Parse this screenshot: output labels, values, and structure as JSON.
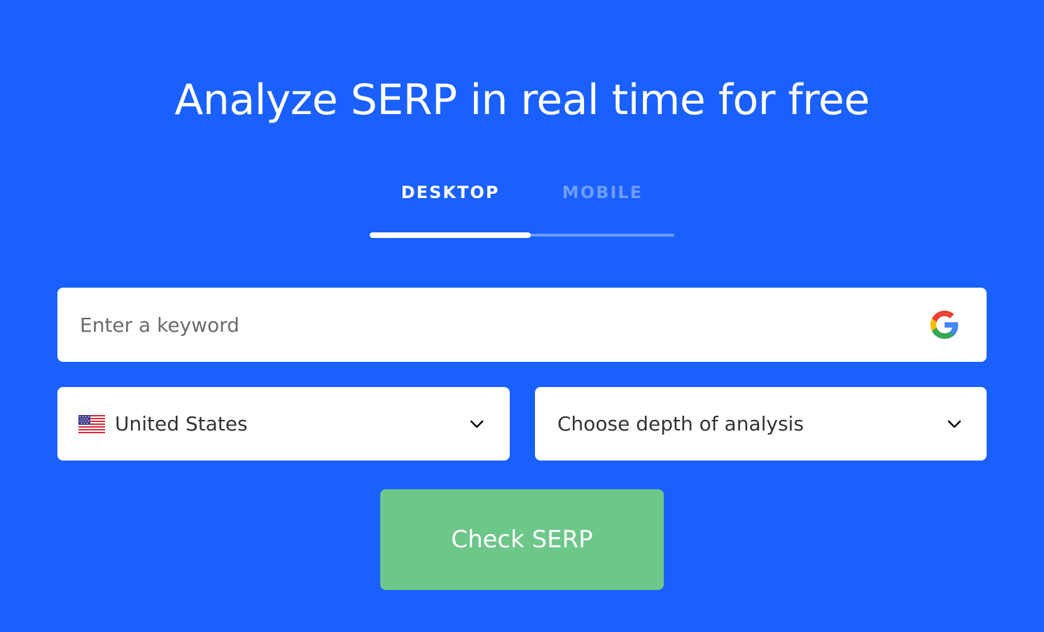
{
  "header": {
    "title": "Analyze SERP in real time for free"
  },
  "tabs": [
    {
      "label": "DESKTOP",
      "active": true
    },
    {
      "label": "MOBILE",
      "active": false
    }
  ],
  "search": {
    "placeholder": "Enter a keyword",
    "value": "",
    "icon": "google-icon"
  },
  "country_select": {
    "value": "United States",
    "icon": "us-flag-icon"
  },
  "depth_select": {
    "value": "Choose depth of analysis"
  },
  "submit": {
    "label": "Check SERP"
  },
  "colors": {
    "background": "#1a60ff",
    "tab_active": "#ffffff",
    "tab_inactive": "#6f9dff",
    "button": "#6cc789"
  }
}
